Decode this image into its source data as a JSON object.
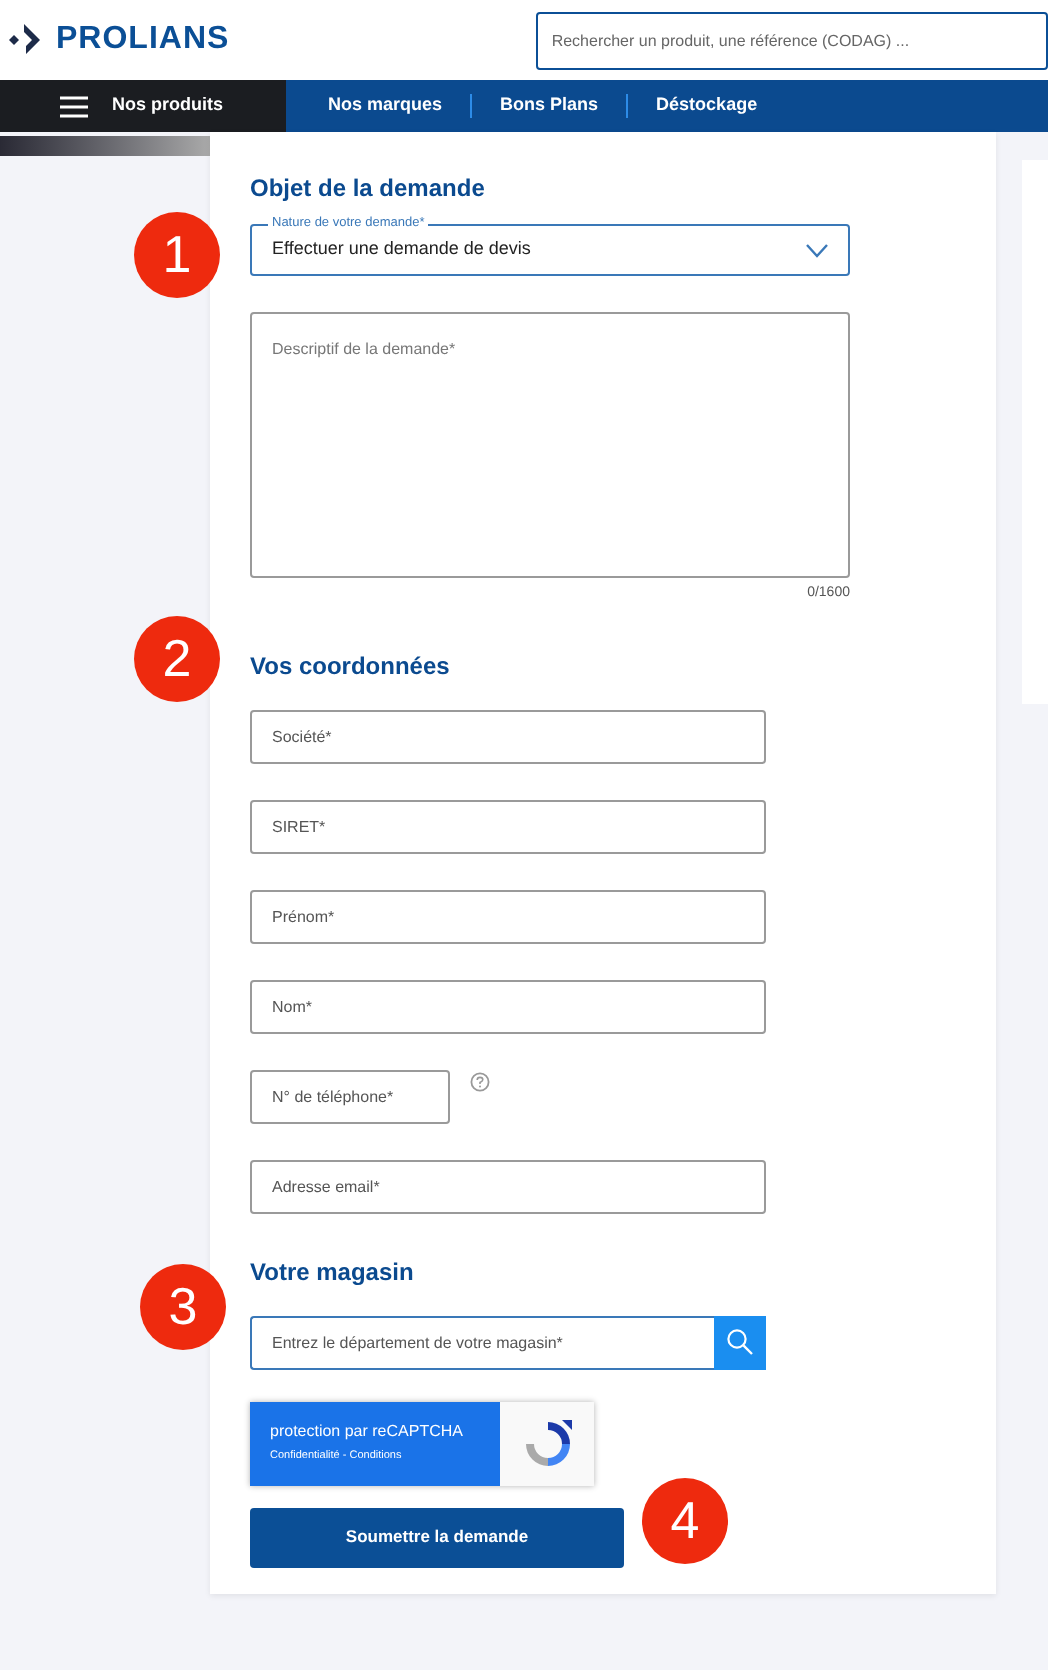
{
  "header": {
    "logo": "PROLIANS",
    "search": {
      "placeholder": "Rechercher un produit, une référence (CODAG) ..."
    }
  },
  "nav": {
    "menu": "Nos produits",
    "links": [
      "Nos marques",
      "Bons Plans",
      "Déstockage"
    ]
  },
  "request": {
    "title": "Objet de la demande",
    "select": {
      "label": "Nature de votre demande*",
      "value": "Effectuer une demande de devis"
    },
    "description": {
      "placeholder": "Descriptif de la demande*"
    },
    "counter": "0/1600"
  },
  "contact": {
    "title": "Vos coordonnées",
    "fields": [
      {
        "kind": "text",
        "placeholder": "Société*"
      },
      {
        "kind": "text",
        "placeholder": "SIRET*"
      },
      {
        "kind": "text",
        "placeholder": "Prénom*"
      },
      {
        "kind": "text",
        "placeholder": "Nom*"
      },
      {
        "kind": "phone",
        "placeholder": "N° de téléphone*"
      },
      {
        "kind": "text",
        "placeholder": "Adresse email*"
      }
    ]
  },
  "store": {
    "title": "Votre magasin",
    "search": {
      "placeholder": "Entrez le département de votre magasin*"
    }
  },
  "recaptcha": {
    "title": "protection par reCAPTCHA",
    "links": "Confidentialité - Conditions"
  },
  "submit": "Soumettre la demande",
  "markers": [
    "1",
    "2",
    "3",
    "4"
  ]
}
